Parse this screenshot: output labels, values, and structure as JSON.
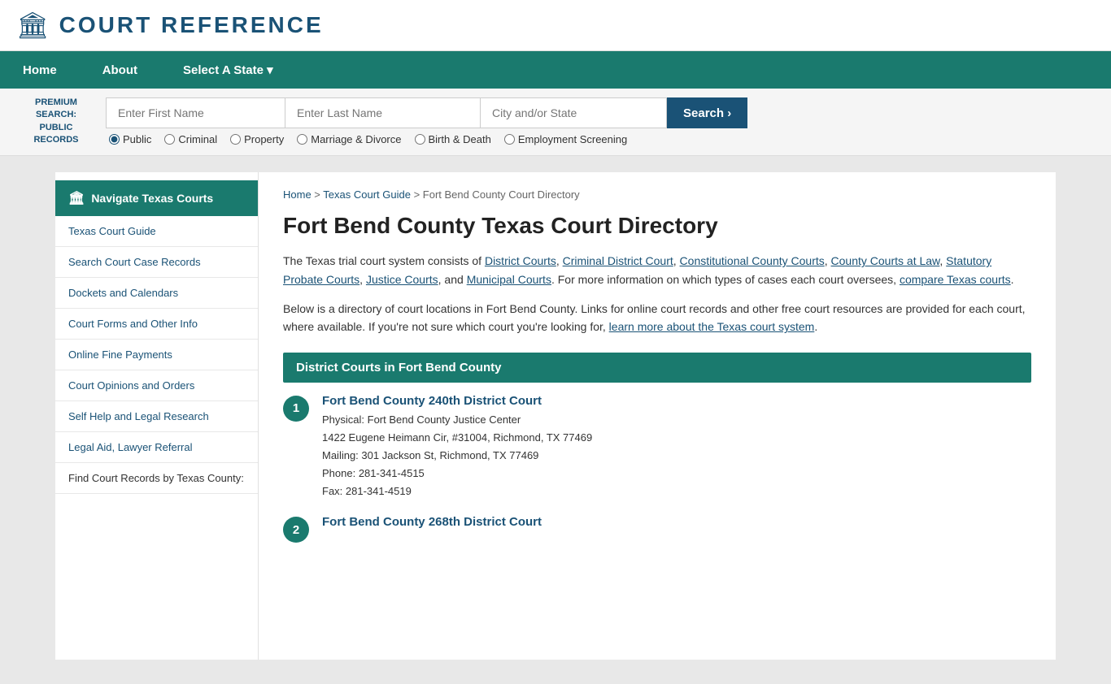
{
  "header": {
    "logo_icon": "🏛",
    "logo_text": "COURT REFERENCE"
  },
  "navbar": {
    "items": [
      {
        "id": "home",
        "label": "Home"
      },
      {
        "id": "about",
        "label": "About"
      },
      {
        "id": "select-state",
        "label": "Select A State ▾"
      }
    ]
  },
  "search": {
    "label_line1": "PREMIUM",
    "label_line2": "SEARCH:",
    "label_line3": "PUBLIC",
    "label_line4": "RECORDS",
    "placeholder_first": "Enter First Name",
    "placeholder_last": "Enter Last Name",
    "placeholder_city": "City and/or State",
    "button_label": "Search ›",
    "radio_options": [
      {
        "id": "public",
        "label": "Public",
        "checked": true
      },
      {
        "id": "criminal",
        "label": "Criminal",
        "checked": false
      },
      {
        "id": "property",
        "label": "Property",
        "checked": false
      },
      {
        "id": "marriage",
        "label": "Marriage & Divorce",
        "checked": false
      },
      {
        "id": "birth",
        "label": "Birth & Death",
        "checked": false
      },
      {
        "id": "employment",
        "label": "Employment Screening",
        "checked": false
      }
    ]
  },
  "breadcrumb": {
    "home": "Home",
    "texas_guide": "Texas Court Guide",
    "current": "Fort Bend County Court Directory"
  },
  "page_title": "Fort Bend County Texas Court Directory",
  "intro_text1": "The Texas trial court system consists of ",
  "intro_links": [
    "District Courts",
    "Criminal District Court",
    "Constitutional County Courts",
    "County Courts at Law",
    "Statutory Probate Courts",
    "Justice Courts",
    "Municipal Courts"
  ],
  "intro_text2": ". For more information on which types of cases each court oversees, ",
  "intro_link2": "compare Texas courts",
  "intro_text3": ".",
  "intro2": "Below is a directory of court locations in Fort Bend County. Links for online court records and other free court resources are provided for each court, where available. If you're not sure which court you're looking for, ",
  "intro2_link": "learn more about the Texas court system",
  "intro2_end": ".",
  "section_header": "District Courts in Fort Bend County",
  "courts": [
    {
      "number": "1",
      "name": "Fort Bend County 240th District Court",
      "physical_label": "Physical: Fort Bend County Justice Center",
      "address": "1422 Eugene Heimann Cir, #31004, Richmond, TX 77469",
      "mailing": "Mailing: 301 Jackson St, Richmond, TX 77469",
      "phone": "Phone: 281-341-4515",
      "fax": "Fax: 281-341-4519"
    },
    {
      "number": "2",
      "name": "Fort Bend County 268th District Court",
      "physical_label": "",
      "address": "",
      "mailing": "",
      "phone": "",
      "fax": ""
    }
  ],
  "sidebar": {
    "active_label": "Navigate Texas Courts",
    "links": [
      "Texas Court Guide",
      "Search Court Case Records",
      "Dockets and Calendars",
      "Court Forms and Other Info",
      "Online Fine Payments",
      "Court Opinions and Orders",
      "Self Help and Legal Research",
      "Legal Aid, Lawyer Referral"
    ],
    "static_text": "Find Court Records by Texas County:"
  }
}
